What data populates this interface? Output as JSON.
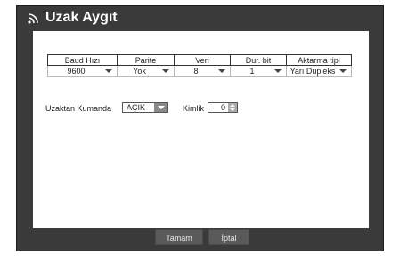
{
  "window": {
    "title": "Uzak Aygıt"
  },
  "serial": {
    "headers": [
      "Baud Hızı",
      "Parite",
      "Veri",
      "Dur. bit",
      "Aktarma tipi"
    ],
    "values": [
      "9600",
      "Yok",
      "8",
      "1",
      "Yarı Dupleks"
    ]
  },
  "remote": {
    "label": "Uzaktan Kumanda",
    "value": "AÇIK",
    "id_label": "Kimlik",
    "id_value": "0"
  },
  "buttons": {
    "ok": "Tamam",
    "cancel": "İptal"
  },
  "colors": {
    "frame": "#3a3a3a",
    "panel": "#ffffff",
    "button": "#5a5a5a"
  },
  "icons": {
    "title": "signal-icon"
  }
}
